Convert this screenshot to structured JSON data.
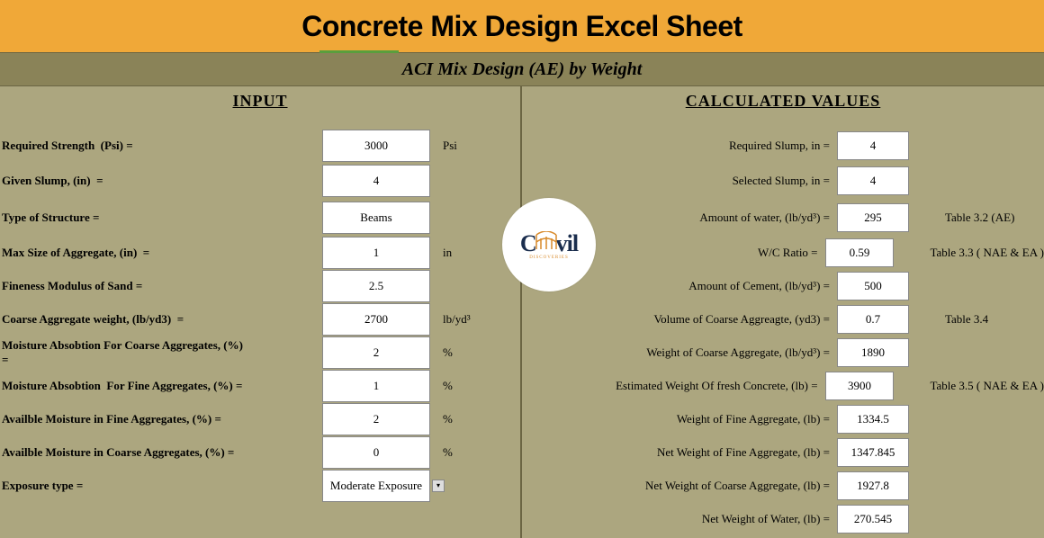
{
  "banner": {
    "title": "Concrete Mix Design Excel Sheet"
  },
  "sheet": {
    "title": "ACI Mix Design (AE) by Weight"
  },
  "logo": {
    "brand_left": "C",
    "brand_right": "vil",
    "sub": "DISCOVERIES"
  },
  "sections": {
    "input": "INPUT",
    "calculated": "CALCULATED VALUES"
  },
  "input_rows": [
    {
      "label": "Required Strength  (Psi) =",
      "value": "3000",
      "unit": "Psi"
    },
    {
      "label": "Given Slump, (in)  =",
      "value": "4",
      "unit": ""
    },
    {
      "label": "Type of Structure =",
      "value": "Beams",
      "unit": ""
    },
    {
      "label": "Max Size of Aggregate, (in)  =",
      "value": "1",
      "unit": "in"
    },
    {
      "label": "Fineness Modulus of Sand =",
      "value": "2.5",
      "unit": ""
    },
    {
      "label": "Coarse Aggregate weight, (lb/yd3)  =",
      "value": "2700",
      "unit": "lb/yd³"
    },
    {
      "label": "Moisture Absobtion For Coarse Aggregates, (%) =",
      "value": "2",
      "unit": "%"
    },
    {
      "label": "Moisture Absobtion  For Fine Aggregates, (%) =",
      "value": "1",
      "unit": "%"
    },
    {
      "label": "Availble Moisture in Fine Aggregates, (%) =",
      "value": "2",
      "unit": "%"
    },
    {
      "label": "Availble Moisture in Coarse Aggregates, (%) =",
      "value": "0",
      "unit": "%"
    },
    {
      "label": "Exposure type =",
      "value": "Moderate Exposure",
      "unit": ""
    }
  ],
  "calc_rows": [
    {
      "label": "Required Slump, in  =",
      "value": "4",
      "ref": ""
    },
    {
      "label": "Selected Slump, in  =",
      "value": "4",
      "ref": ""
    },
    {
      "label": "Amount of water, (lb/yd³)  =",
      "value": "295",
      "ref": "Table 3.2  (AE)"
    },
    {
      "label": "W/C Ratio  =",
      "value": "0.59",
      "ref": "Table 3.3 ( NAE & EA )"
    },
    {
      "label": "Amount of Cement, (lb/yd³) =",
      "value": "500",
      "ref": ""
    },
    {
      "label": "Volume of Coarse Aggreagte, (yd3)  =",
      "value": "0.7",
      "ref": "Table 3.4"
    },
    {
      "label": "Weight of Coarse Aggregate, (lb/yd³) =",
      "value": "1890",
      "ref": ""
    },
    {
      "label": "Estimated Weight Of fresh Concrete, (lb) =",
      "value": "3900",
      "ref": "Table 3.5 ( NAE & EA )"
    },
    {
      "label": "Weight of Fine Aggregate, (lb)  =",
      "value": "1334.5",
      "ref": ""
    },
    {
      "label": "Net Weight of Fine Aggregate, (lb)  =",
      "value": "1347.845",
      "ref": ""
    },
    {
      "label": "Net Weight of Coarse Aggregate, (lb)  =",
      "value": "1927.8",
      "ref": ""
    },
    {
      "label": "Net Weight of Water, (lb)  =",
      "value": "270.545",
      "ref": ""
    }
  ]
}
